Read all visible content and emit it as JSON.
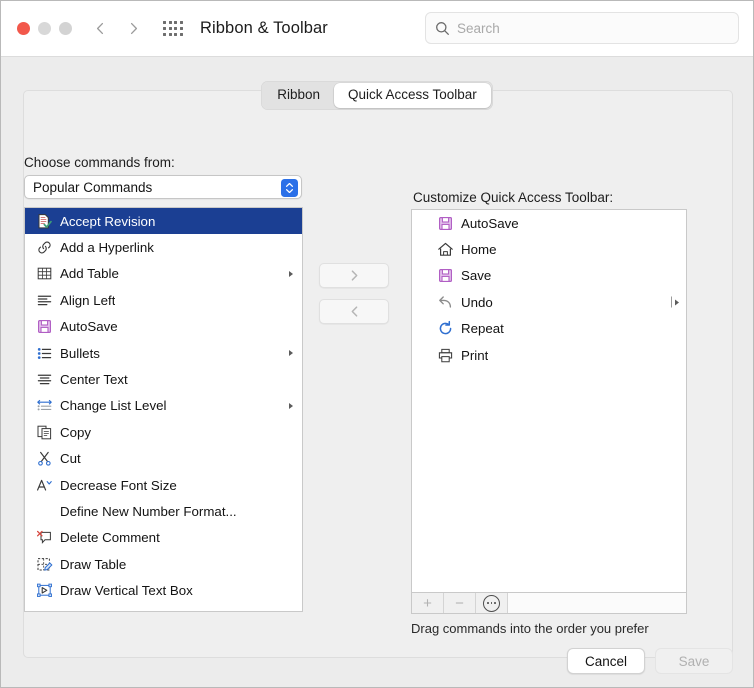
{
  "window": {
    "title": "Ribbon & Toolbar",
    "traffic_lights": [
      "close",
      "minimize",
      "zoom"
    ],
    "nav": {
      "back": "back-chevron",
      "forward": "forward-chevron"
    },
    "grid_button": "all-preferences-grid"
  },
  "search": {
    "placeholder": "Search",
    "icon": "search-icon"
  },
  "tabs": [
    {
      "label": "Ribbon",
      "active": false
    },
    {
      "label": "Quick Access Toolbar",
      "active": true
    }
  ],
  "choose_commands": {
    "label": "Choose commands from:",
    "value": "Popular Commands"
  },
  "customize": {
    "label": "Customize Quick Access Toolbar:",
    "hint": "Drag commands into the order you prefer"
  },
  "commands_list": [
    {
      "label": "Accept Revision",
      "icon": "accept-revision-icon",
      "selected": true,
      "submenu": false
    },
    {
      "label": "Add a Hyperlink",
      "icon": "hyperlink-icon",
      "selected": false,
      "submenu": false
    },
    {
      "label": "Add Table",
      "icon": "table-icon",
      "selected": false,
      "submenu": true
    },
    {
      "label": "Align Left",
      "icon": "align-left-icon",
      "selected": false,
      "submenu": false
    },
    {
      "label": "AutoSave",
      "icon": "floppy-icon",
      "selected": false,
      "submenu": false
    },
    {
      "label": "Bullets",
      "icon": "bullets-icon",
      "selected": false,
      "submenu": true
    },
    {
      "label": "Center Text",
      "icon": "align-center-icon",
      "selected": false,
      "submenu": false
    },
    {
      "label": "Change List Level",
      "icon": "change-list-level-icon",
      "selected": false,
      "submenu": true
    },
    {
      "label": "Copy",
      "icon": "copy-icon",
      "selected": false,
      "submenu": false
    },
    {
      "label": "Cut",
      "icon": "scissors-icon",
      "selected": false,
      "submenu": false
    },
    {
      "label": "Decrease Font Size",
      "icon": "decrease-font-size-icon",
      "selected": false,
      "submenu": false
    },
    {
      "label": "Define New Number Format...",
      "icon": "none",
      "selected": false,
      "submenu": false
    },
    {
      "label": "Delete Comment",
      "icon": "delete-comment-icon",
      "selected": false,
      "submenu": false
    },
    {
      "label": "Draw Table",
      "icon": "draw-table-icon",
      "selected": false,
      "submenu": false
    },
    {
      "label": "Draw Vertical Text Box",
      "icon": "draw-vertical-text-box-icon",
      "selected": false,
      "submenu": false
    }
  ],
  "toolbar_list": [
    {
      "label": "AutoSave",
      "icon": "floppy-icon",
      "submenu": false
    },
    {
      "label": "Home",
      "icon": "home-icon",
      "submenu": false
    },
    {
      "label": "Save",
      "icon": "floppy-icon",
      "submenu": false
    },
    {
      "label": "Undo",
      "icon": "undo-icon",
      "submenu": true
    },
    {
      "label": "Repeat",
      "icon": "repeat-icon",
      "submenu": false
    },
    {
      "label": "Print",
      "icon": "print-icon",
      "submenu": false
    }
  ],
  "transfer": {
    "add_label": "move-right",
    "remove_label": "move-left"
  },
  "list_toolbar": {
    "add": "+",
    "remove": "−",
    "more": "more-options-icon"
  },
  "footer": {
    "cancel": "Cancel",
    "save": "Save",
    "save_enabled": false
  },
  "colors": {
    "selection": "#1b3f93",
    "accent": "#2b70e8",
    "close_light": "#f2584b",
    "floppy": "#b15fc4"
  }
}
